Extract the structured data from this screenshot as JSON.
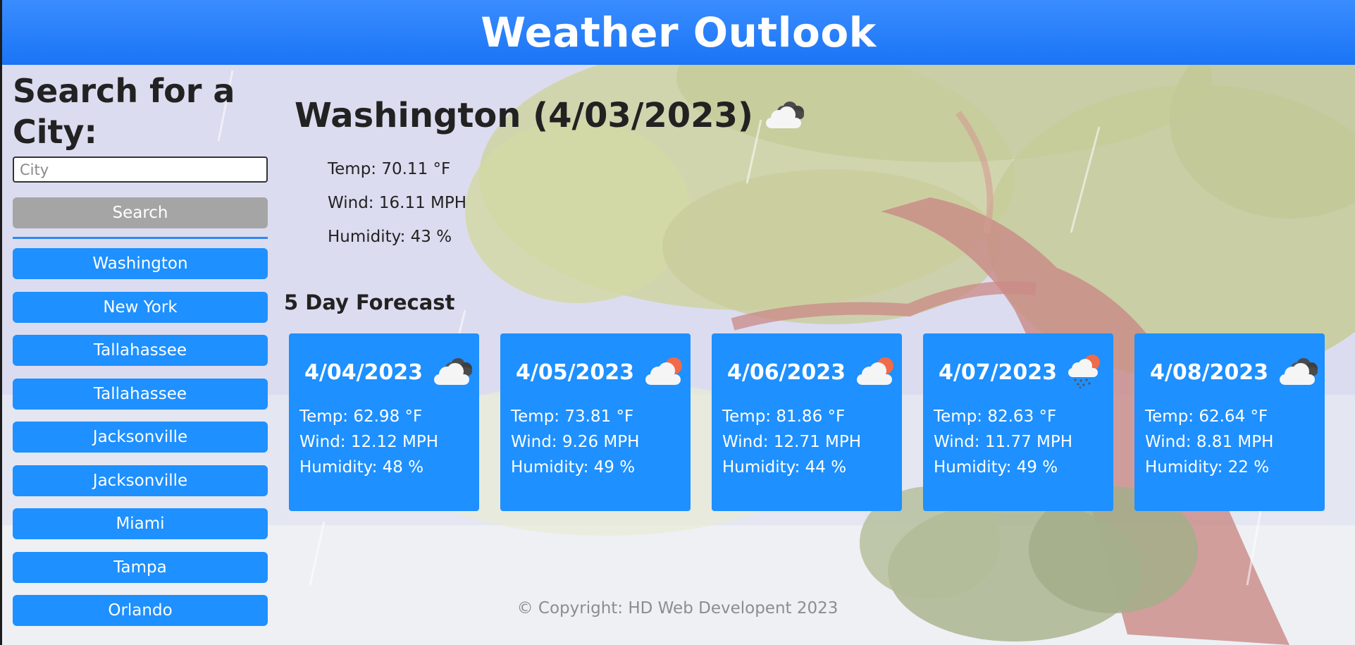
{
  "header": {
    "title": "Weather Outlook"
  },
  "sidebar": {
    "heading": "Search for a City:",
    "input_placeholder": "City",
    "search_label": "Search",
    "history": [
      "Washington",
      "New York",
      "Tallahassee",
      "Tallahassee",
      "Jacksonville",
      "Jacksonville",
      "Miami",
      "Tampa",
      "Orlando"
    ]
  },
  "current": {
    "title": "Washington (4/03/2023)",
    "icon": "cloudy-icon",
    "temp": "Temp: 70.11 °F",
    "wind": "Wind: 16.11 MPH",
    "humidity": "Humidity: 43 %"
  },
  "forecast": {
    "title": "5 Day Forecast",
    "days": [
      {
        "date": "4/04/2023",
        "icon": "cloudy-icon",
        "temp": "Temp: 62.98 °F",
        "wind": "Wind: 12.12 MPH",
        "humidity": "Humidity: 48 %"
      },
      {
        "date": "4/05/2023",
        "icon": "partly-sunny-icon",
        "temp": "Temp: 73.81 °F",
        "wind": "Wind: 9.26 MPH",
        "humidity": "Humidity: 49 %"
      },
      {
        "date": "4/06/2023",
        "icon": "partly-sunny-icon",
        "temp": "Temp: 81.86 °F",
        "wind": "Wind: 12.71 MPH",
        "humidity": "Humidity: 44 %"
      },
      {
        "date": "4/07/2023",
        "icon": "rain-sun-icon",
        "temp": "Temp: 82.63 °F",
        "wind": "Wind: 11.77 MPH",
        "humidity": "Humidity: 49 %"
      },
      {
        "date": "4/08/2023",
        "icon": "cloudy-icon",
        "temp": "Temp: 62.64 °F",
        "wind": "Wind: 8.81 MPH",
        "humidity": "Humidity: 22 %"
      }
    ]
  },
  "footer": {
    "text": "© Copyright: HD Web Developent 2023"
  },
  "colors": {
    "header": "#1a74f5",
    "button": "#1e90ff",
    "search_button": "#a5a5a5",
    "card": "#1e90ff"
  }
}
